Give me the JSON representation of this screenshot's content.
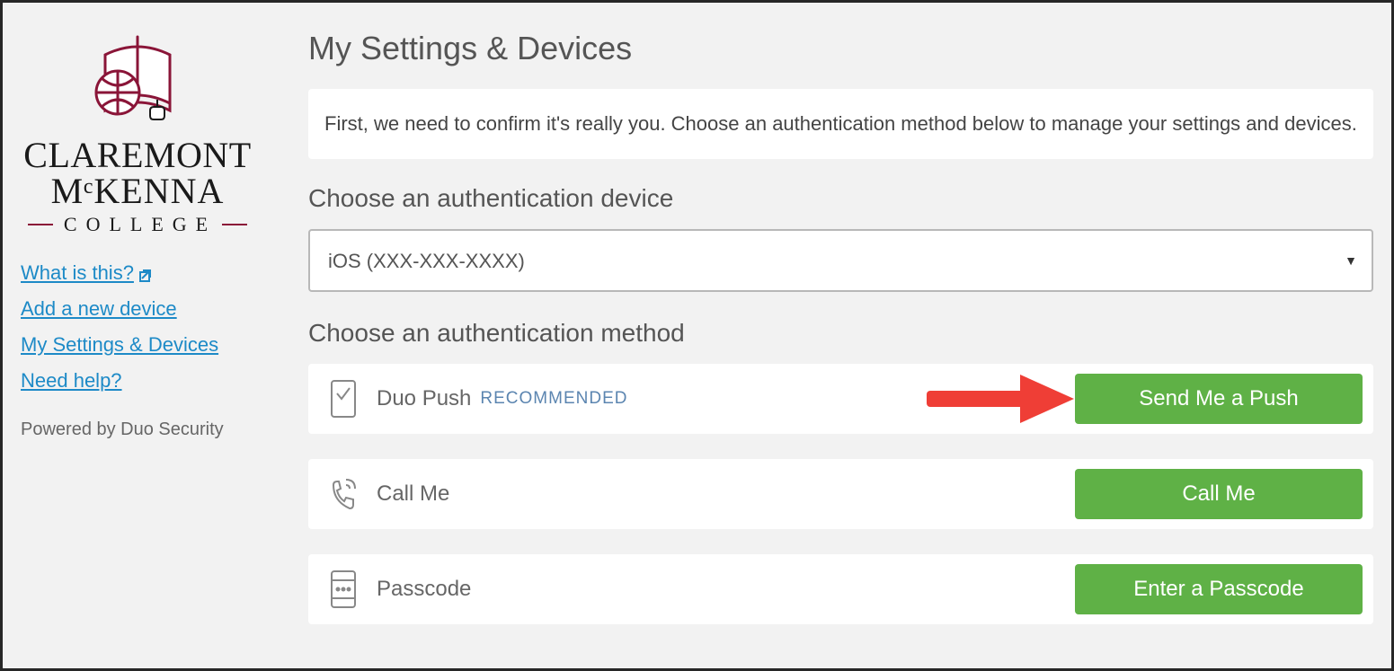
{
  "brand": {
    "line1": "CLAREMONT",
    "line2": "MᶜKENNA",
    "line3": "COLLEGE",
    "accent": "#8a1538"
  },
  "sidebar": {
    "links": [
      {
        "label": "What is this?",
        "external": true
      },
      {
        "label": "Add a new device",
        "external": false
      },
      {
        "label": "My Settings & Devices",
        "external": false
      },
      {
        "label": "Need help?",
        "external": false
      }
    ],
    "powered": "Powered by Duo Security"
  },
  "page": {
    "title": "My Settings & Devices",
    "instructions": "First, we need to confirm it's really you. Choose an authentication method below to manage your settings and devices.",
    "device_section_label": "Choose an authentication device",
    "method_section_label": "Choose an authentication method"
  },
  "device_select": {
    "selected": "iOS (XXX-XXX-XXXX)"
  },
  "methods": [
    {
      "icon": "phone-check-icon",
      "label": "Duo Push",
      "recommended": "RECOMMENDED",
      "button": "Send Me a Push",
      "annotated": true
    },
    {
      "icon": "phone-call-icon",
      "label": "Call Me",
      "recommended": "",
      "button": "Call Me",
      "annotated": false
    },
    {
      "icon": "passcode-icon",
      "label": "Passcode",
      "recommended": "",
      "button": "Enter a Passcode",
      "annotated": false
    }
  ],
  "colors": {
    "button_green": "#5fb146",
    "link_blue": "#1d8ac7",
    "arrow_red": "#ef3e36"
  }
}
